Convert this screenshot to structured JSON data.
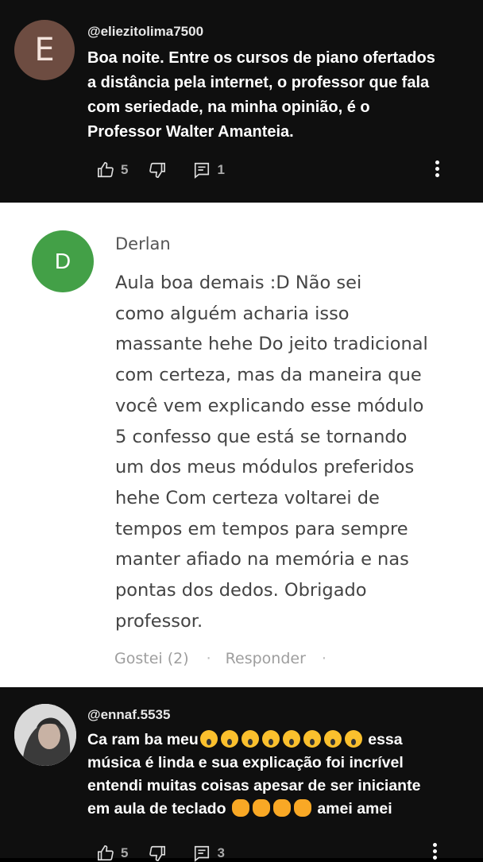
{
  "comment1": {
    "avatar_letter": "E",
    "author": "@eliezitolima7500",
    "lines": [
      "Boa noite. Entre os cursos de piano ofertados",
      "a distância pela internet, o professor que fala",
      "com seriedade, na minha opinião, é o",
      "Professor Walter Amanteia."
    ],
    "likes": "5",
    "replies": "1"
  },
  "comment2": {
    "avatar_letter": "D",
    "author": "Derlan",
    "text": "Aula boa demais :D      Não sei\ncomo alguém acharia isso\nmassante hehe Do jeito tradicional\ncom certeza, mas da maneira que\nvocê vem explicando esse módulo\n5 confesso que está se tornando\num dos meus módulos preferidos\nhehe Com certeza voltarei de\ntempos em tempos para sempre\nmanter afiado na memória e nas\npontas dos dedos.   Obrigado\nprofessor.",
    "like_label": "Gostei (2)",
    "reply_label": "Responder"
  },
  "comment3": {
    "author": "@ennaf.5535",
    "line1_prefix": "Ca ram ba meu",
    "line1_suffix": "essa",
    "line2": "música é linda e sua explicação foi incrível",
    "line3": "entendi muitas coisas apesar de ser iniciante",
    "line4_prefix": "em aula de teclado",
    "line4_suffix": "amei amei",
    "likes": "5",
    "replies": "3"
  },
  "colors": {
    "dark_bg": "#0f0f0f",
    "avatar_e": "#6d4c41",
    "avatar_d": "#43a047"
  },
  "icons": [
    "thumb-up-icon",
    "thumb-down-icon",
    "comment-icon",
    "more-vert-icon",
    "scream-emoji",
    "clap-emoji"
  ]
}
